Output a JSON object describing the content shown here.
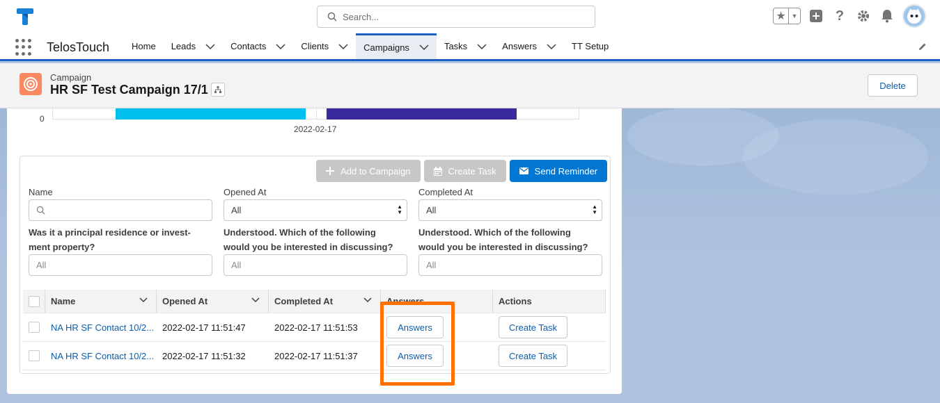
{
  "global_header": {
    "search_placeholder": "Search..."
  },
  "nav": {
    "app_name": "TelosTouch",
    "items": [
      {
        "label": "Home",
        "has_menu": false
      },
      {
        "label": "Leads",
        "has_menu": true
      },
      {
        "label": "Contacts",
        "has_menu": true
      },
      {
        "label": "Clients",
        "has_menu": true
      },
      {
        "label": "Campaigns",
        "has_menu": true,
        "active": true
      },
      {
        "label": "Tasks",
        "has_menu": true
      },
      {
        "label": "Answers",
        "has_menu": true
      },
      {
        "label": "TT Setup",
        "has_menu": false
      }
    ]
  },
  "record": {
    "type": "Campaign",
    "title": "HR SF Test Campaign 17/1",
    "delete_label": "Delete"
  },
  "chart": {
    "y_tick": "0",
    "x_tick": "2022-02-17",
    "colors": {
      "bar1": "#00c0f0",
      "bar2": "#3a2aa0"
    }
  },
  "actions": {
    "add_to_campaign": "Add to Campaign",
    "create_task": "Create Task",
    "send_reminder": "Send Reminder"
  },
  "filters": {
    "name_label": "Name",
    "opened_label": "Opened At",
    "opened_value": "All",
    "completed_label": "Completed At",
    "completed_value": "All",
    "q1_label": "Was it a principal residence or investment property?",
    "q1_line1": "Was it a principal residence or invest-",
    "q1_line2": "ment property?",
    "q1_placeholder": "All",
    "q2_line1": "Understood. Which of the following",
    "q2_line2": "would you be interested in discussing?",
    "q2_placeholder": "All",
    "q3_line1": "Understood. Which of the following",
    "q3_line2": "would you be interested in discussing?",
    "q3_placeholder": "All"
  },
  "table": {
    "headers": [
      "Name",
      "Opened At",
      "Completed At",
      "Answers",
      "Actions"
    ],
    "rows": [
      {
        "name": "NA HR SF Contact 10/2...",
        "opened": "2022-02-17 11:51:47",
        "completed": "2022-02-17 11:51:53",
        "answers_btn": "Answers",
        "action_btn": "Create Task"
      },
      {
        "name": "NA HR SF Contact 10/2...",
        "opened": "2022-02-17 11:51:32",
        "completed": "2022-02-17 11:51:37",
        "answers_btn": "Answers",
        "action_btn": "Create Task"
      }
    ]
  },
  "accent_colors": {
    "brand": "#0176d3",
    "nav_active": "#1b5fc1",
    "highlight": "#ff7200",
    "campaign_icon": "#f88962"
  }
}
